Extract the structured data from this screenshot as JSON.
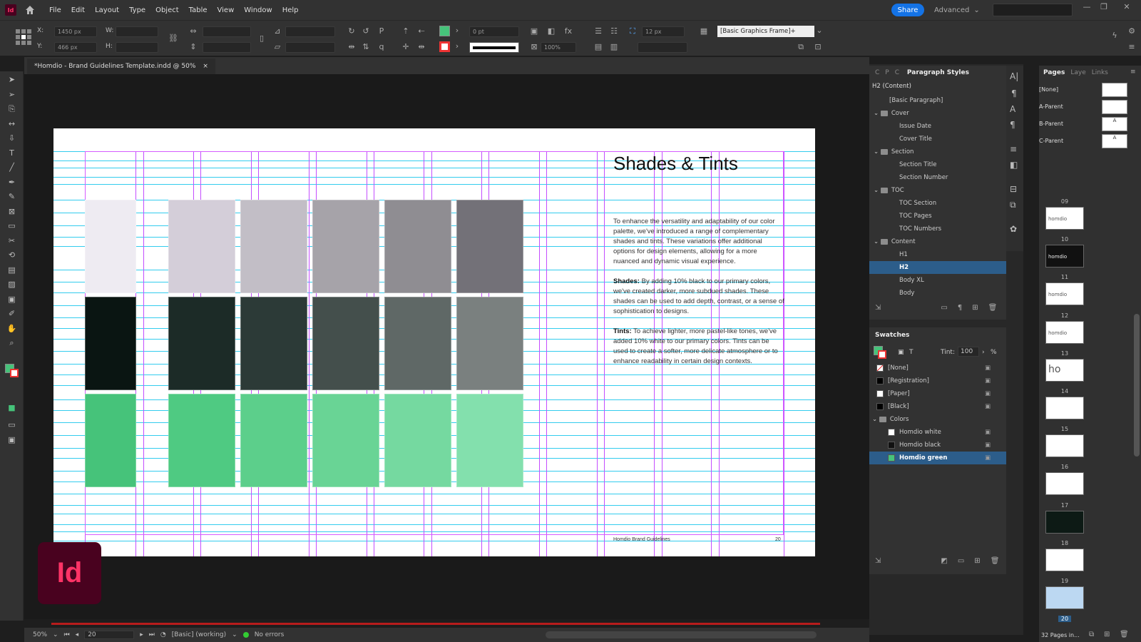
{
  "app": {
    "short": "Id",
    "logo_text": "Id"
  },
  "menu": [
    "File",
    "Edit",
    "Layout",
    "Type",
    "Object",
    "Table",
    "View",
    "Window",
    "Help"
  ],
  "topbar": {
    "share_label": "Share",
    "workspace_label": "Advanced"
  },
  "control": {
    "x_label": "X:",
    "y_label": "Y:",
    "w_label": "W:",
    "h_label": "H:",
    "x_value": "1450 px",
    "y_value": "466 px",
    "stroke_weight": "0 pt",
    "opacity": "100%",
    "gap": "12 px",
    "object_style": "[Basic Graphics Frame]+"
  },
  "document": {
    "tab_title": "*Homdio - Brand Guidelines Template.indd @ 50%",
    "close": "×"
  },
  "spread": {
    "heading": "Shades & Tints",
    "intro": "To enhance the versatility and adaptability of our color palette, we've introduced a range of complementary shades and tints. These variations offer additional options for design elements, allowing for a more nuanced and dynamic visual experience.",
    "shades_label": "Shades:",
    "shades_text": "By adding 10% black to our primary colors, we've created darker, more subdued shades. These shades can be used to add depth, contrast, or a sense of sophistication to designs.",
    "tints_label": "Tints:",
    "tints_text": "To achieve lighter, more pastel-like tones, we've added 10% white to our primary colors. Tints can be used to create a softer, more delicate atmosphere or to enhance readability in certain design contexts.",
    "footer_left": "Homdio Brand Guidelines",
    "footer_page": "20",
    "palette_rows": [
      [
        "#eeebf2",
        "#d4ced9",
        "#c2bec6",
        "#a6a3a9",
        "#8f8d92",
        "#737178"
      ],
      [
        "#0a1512",
        "#1c2b27",
        "#2c3a37",
        "#444f4c",
        "#5f6866",
        "#7a807f"
      ],
      [
        "#46c37a",
        "#4fca82",
        "#5ccf8b",
        "#69d495",
        "#75d9a0",
        "#83e0ad"
      ]
    ]
  },
  "paragraph_styles": {
    "tabs": [
      "C",
      "P",
      "C"
    ],
    "title": "Paragraph Styles",
    "current": "H2 (Content)",
    "items": [
      {
        "label": "[Basic Paragraph]",
        "level": 1,
        "folder": false
      },
      {
        "label": "Cover",
        "level": 0,
        "folder": true
      },
      {
        "label": "Issue Date",
        "level": 2,
        "folder": false
      },
      {
        "label": "Cover Title",
        "level": 2,
        "folder": false
      },
      {
        "label": "Section",
        "level": 0,
        "folder": true
      },
      {
        "label": "Section Title",
        "level": 2,
        "folder": false
      },
      {
        "label": "Section Number",
        "level": 2,
        "folder": false
      },
      {
        "label": "TOC",
        "level": 0,
        "folder": true
      },
      {
        "label": "TOC Section",
        "level": 2,
        "folder": false
      },
      {
        "label": "TOC Pages",
        "level": 2,
        "folder": false
      },
      {
        "label": "TOC Numbers",
        "level": 2,
        "folder": false
      },
      {
        "label": "Content",
        "level": 0,
        "folder": true
      },
      {
        "label": "H1",
        "level": 2,
        "folder": false
      },
      {
        "label": "H2",
        "level": 2,
        "folder": false,
        "selected": true
      },
      {
        "label": "Body XL",
        "level": 2,
        "folder": false
      },
      {
        "label": "Body",
        "level": 2,
        "folder": false
      }
    ]
  },
  "swatches": {
    "title": "Swatches",
    "tint_label": "Tint:",
    "tint_value": "100",
    "percent": "%",
    "items": [
      {
        "label": "[None]",
        "color": "#ffffff",
        "none": true
      },
      {
        "label": "[Registration]",
        "color": "#000000"
      },
      {
        "label": "[Paper]",
        "color": "#ffffff"
      },
      {
        "label": "[Black]",
        "color": "#000000"
      },
      {
        "label": "Colors",
        "folder": true
      },
      {
        "label": "Homdio white",
        "color": "#ffffff",
        "indent": true
      },
      {
        "label": "Homdio black",
        "color": "#111111",
        "indent": true
      },
      {
        "label": "Homdio green",
        "color": "#46c37a",
        "indent": true,
        "selected": true
      }
    ]
  },
  "pages": {
    "tabs": [
      "Pages",
      "Laye",
      "Links"
    ],
    "parents": [
      {
        "label": "[None]",
        "mark": ""
      },
      {
        "label": "A-Parent",
        "mark": ""
      },
      {
        "label": "B-Parent",
        "mark": "A"
      },
      {
        "label": "C-Parent",
        "mark": "A"
      }
    ],
    "page_numbers": [
      "09",
      "10",
      "11",
      "12",
      "13",
      "14",
      "15",
      "16",
      "17",
      "18",
      "19",
      "20"
    ],
    "thumb_text": [
      "homdio",
      "homdio",
      "homdio",
      "homdio",
      "ho",
      "",
      "",
      "",
      "",
      "",
      "",
      ""
    ],
    "footer": "32 Pages in..."
  },
  "status": {
    "zoom": "50%",
    "page": "20",
    "style": "[Basic] (working)",
    "errors": "No errors"
  }
}
